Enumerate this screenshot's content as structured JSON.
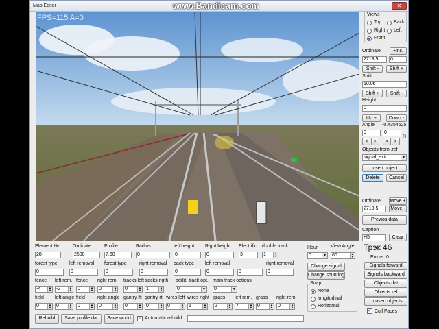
{
  "window": {
    "title": "Map Editor",
    "close_glyph": "✕"
  },
  "watermark": "www.Bandicam.com",
  "viewport": {
    "fps": "FPS=115  A=0"
  },
  "right_panel": {
    "views_label": "Views",
    "views": [
      {
        "label": "Top",
        "checked": false
      },
      {
        "label": "Back",
        "checked": false
      },
      {
        "label": "Right",
        "checked": false
      },
      {
        "label": "Left",
        "checked": false
      },
      {
        "label": "Front",
        "checked": true
      }
    ],
    "ordinate_label": "Ordinate",
    "ins_button": "+ins.",
    "ordinate_value": "2713.5",
    "ordinate_value2": "0",
    "shift_minus": "Shift -",
    "shift_plus": "Shift +",
    "shift_label": "Shift",
    "shift_value": "10.06",
    "shift_plus2": "Shift +",
    "shift_minus2": "Shift -",
    "height_label": "Height",
    "height_value": "0",
    "up_button": "Up +",
    "down_button": "Down -",
    "angle_label": "Angle",
    "angle_value": "-0.4354525",
    "angle_box1": "0",
    "angle_box2": "0",
    "angle_box3": "0",
    "angle_arrows": [
      "<",
      ">",
      "<",
      ">"
    ],
    "objects_from_label": "Objects from  .ref",
    "objects_select": "signal_exit",
    "insert_button": "Insert object",
    "delete_button": "Delete",
    "cancel_button": "Cancel",
    "ordinate2_label": "Ordinate",
    "move_plus": "Move +",
    "ordinate2_value": "2713.5",
    "move_minus": "Move -",
    "prev_data_button": "Previos data",
    "caption_label": "Caption",
    "caption_value": "H5",
    "clear_button": "Clear"
  },
  "bottom": {
    "row1_labels": [
      "Element №",
      "Ordinate",
      "Profile",
      "Radius",
      "left height",
      "Right height",
      "Electrific.",
      "double track"
    ],
    "row1_values": [
      "28",
      "2500",
      "7.60",
      "0",
      "0",
      "0",
      "3",
      "1"
    ],
    "row2_labels": [
      "forest type",
      "left removal",
      "forest type",
      "right removal",
      "back type",
      "left removal",
      "right removal"
    ],
    "row2_values": [
      "0",
      "0",
      "0",
      "0",
      "0",
      "0",
      "0",
      "0"
    ],
    "row3_labels": [
      "fence",
      "left rem.",
      "fence",
      "right rem.",
      "tracks left",
      "tracks rigth",
      "addit. track opt.",
      "main track options"
    ],
    "row3_values": [
      "-4",
      "-2",
      "0",
      "0",
      "0",
      "1",
      "0",
      "0"
    ],
    "row4_labels": [
      "field",
      "left angle",
      "field",
      "right angle",
      "gantry lft",
      "gantry rt",
      "wires left",
      "wires right",
      "grass",
      "left rem.",
      "grass",
      "right rem."
    ],
    "row4_values": [
      "0",
      "0",
      "0",
      "0",
      "0",
      "0",
      "0",
      "1",
      "2",
      "7",
      "0",
      "0"
    ],
    "rebuild_button": "Rebuild",
    "save_profile_button": "Save profile.dat",
    "save_world_button": "Save world",
    "auto_rebuild_label": "Automatic rebuild",
    "auto_rebuild_checked": true,
    "hour_label": "Hour",
    "hour_value": "0",
    "view_angle_label": "View Angle",
    "view_angle_value": "60",
    "change_signal_button": "Change signal",
    "change_shunting_button": "Change shunting",
    "snap_label": "Snap",
    "snap_options": [
      {
        "label": "None",
        "checked": true
      },
      {
        "label": "longitudinal",
        "checked": false
      },
      {
        "label": "Horizontal",
        "checked": false
      }
    ],
    "track_label": "Трэк 46",
    "errors_label": "Errors: 0",
    "signals_forward_button": "Signals forward",
    "signals_backward_button": "Signals backward",
    "objects_dat_button": "Objects.dat",
    "objects_ref_button": "Objects.ref",
    "unused_objects_button": "Unused objects",
    "cull_faces_label": "Cull Faces",
    "cull_faces_checked": true
  },
  "colors": {
    "sky": "#6fa2d8",
    "ground": "#6b6a4a",
    "rail": "#b9b9b9",
    "signal_yellow": "#f2d21b",
    "signal_green": "#27c23a"
  }
}
